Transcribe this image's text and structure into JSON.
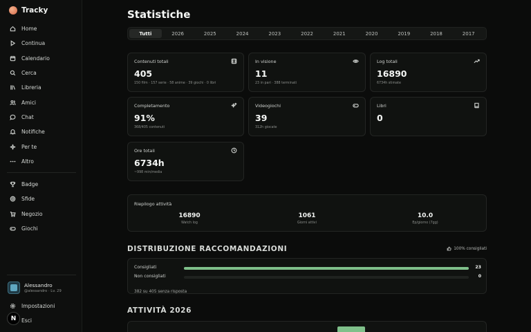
{
  "app": {
    "name": "Tracky"
  },
  "sidebar": {
    "items": [
      {
        "label": "Home",
        "icon": "home-icon"
      },
      {
        "label": "Continua",
        "icon": "play-icon"
      },
      {
        "label": "Calendario",
        "icon": "calendar-icon"
      },
      {
        "label": "Cerca",
        "icon": "search-icon"
      },
      {
        "label": "Libreria",
        "icon": "library-icon"
      },
      {
        "label": "Amici",
        "icon": "friends-icon"
      },
      {
        "label": "Chat",
        "icon": "chat-icon"
      },
      {
        "label": "Notifiche",
        "icon": "bell-icon"
      },
      {
        "label": "Per te",
        "icon": "sparkle-icon"
      },
      {
        "label": "Altro",
        "icon": "more-icon"
      }
    ],
    "items2": [
      {
        "label": "Badge",
        "icon": "trophy-icon"
      },
      {
        "label": "Sfide",
        "icon": "target-icon"
      },
      {
        "label": "Negozio",
        "icon": "cart-icon"
      },
      {
        "label": "Giochi",
        "icon": "gamepad-icon"
      }
    ],
    "user": {
      "name": "Alessandro",
      "sub": "@alessandro · Lv. 29"
    },
    "footer": [
      {
        "label": "Impostazioni",
        "icon": "gear-icon"
      },
      {
        "label": "Esci",
        "icon": "logout-icon"
      }
    ],
    "next_badge": "N"
  },
  "page": {
    "title": "Statistiche"
  },
  "tabs": [
    "Tutti",
    "2026",
    "2025",
    "2024",
    "2023",
    "2022",
    "2021",
    "2020",
    "2019",
    "2018",
    "2017"
  ],
  "active_tab": "Tutti",
  "stats": [
    {
      "label": "Contenuti totali",
      "value": "405",
      "sub": "150 film · 157 serie · 58 anime · 39 giochi · 0 libri",
      "icon": "film-icon"
    },
    {
      "label": "In visione",
      "value": "11",
      "sub": "23 in pari · 388 terminati",
      "icon": "eye-icon"
    },
    {
      "label": "Log totali",
      "value": "16890",
      "sub": "6734h stimate",
      "icon": "trend-up-icon"
    },
    {
      "label": "Completamento",
      "value": "91%",
      "sub": "368/405 contenuti",
      "icon": "sparkle-icon"
    },
    {
      "label": "Videogiochi",
      "value": "39",
      "sub": "312h giocate",
      "icon": "gamepad-icon"
    },
    {
      "label": "Libri",
      "value": "0",
      "sub": "",
      "icon": "book-icon"
    },
    {
      "label": "Ore totali",
      "value": "6734h",
      "sub": "~998 min/media",
      "icon": "clock-icon"
    }
  ],
  "summary": {
    "title": "Riepilogo attività",
    "cols": [
      {
        "value": "16890",
        "label": "Watch log"
      },
      {
        "value": "1061",
        "label": "Giorni attivi"
      },
      {
        "value": "10.0",
        "label": "Ep/giorno (7gg)"
      }
    ]
  },
  "recommendations": {
    "title": "DISTRIBUZIONE RACCOMANDAZIONI",
    "note": "100% consigliati",
    "rows": [
      {
        "label": "Consigliati",
        "count": "23",
        "fraction": 1.0
      },
      {
        "label": "Non consigliati",
        "count": "0",
        "fraction": 0.0
      }
    ],
    "footer": "382 su 405 senza risposta"
  },
  "activity": {
    "title": "ATTIVITÀ 2026"
  },
  "colors": {
    "accent": "#7fc08a",
    "background": "#0b0c0b",
    "card": "#101210"
  }
}
